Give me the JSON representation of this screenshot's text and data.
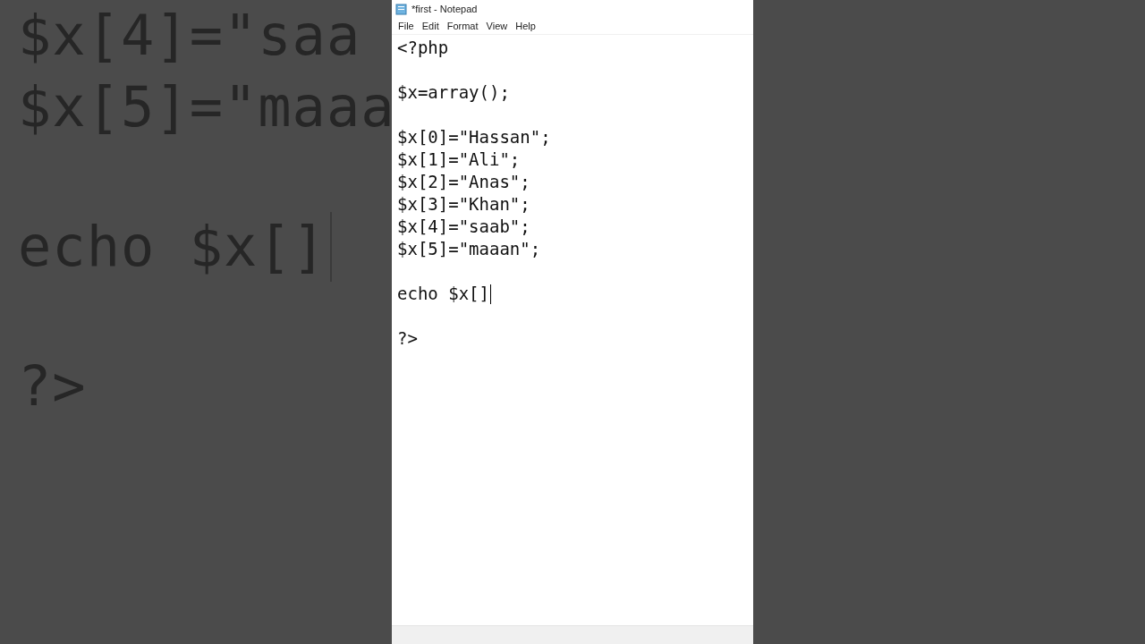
{
  "backdrop": {
    "lines": [
      {
        "text": "$x[4]=\"saa"
      },
      {
        "text": "$x[5]=\"maaa"
      },
      {
        "text": "echo $x[]",
        "caret": true
      },
      {
        "text": "?>",
        "caret": false
      }
    ]
  },
  "window": {
    "title": "*first - Notepad"
  },
  "menu": [
    "File",
    "Edit",
    "Format",
    "View",
    "Help"
  ],
  "editor": {
    "blocks": [
      [
        {
          "text": "<?php",
          "caret": false
        }
      ],
      [
        {
          "text": "$x=array();",
          "caret": false
        }
      ],
      [
        {
          "text": "$x[0]=\"Hassan\";",
          "caret": false
        },
        {
          "text": "$x[1]=\"Ali\";",
          "caret": false
        },
        {
          "text": "$x[2]=\"Anas\";",
          "caret": false
        },
        {
          "text": "$x[3]=\"Khan\";",
          "caret": false
        },
        {
          "text": "$x[4]=\"saab\";",
          "caret": false
        },
        {
          "text": "$x[5]=\"maaan\";",
          "caret": false
        }
      ],
      [
        {
          "text": "echo $x[]",
          "caret": true
        }
      ],
      [
        {
          "text": "?>",
          "caret": false
        }
      ]
    ]
  }
}
